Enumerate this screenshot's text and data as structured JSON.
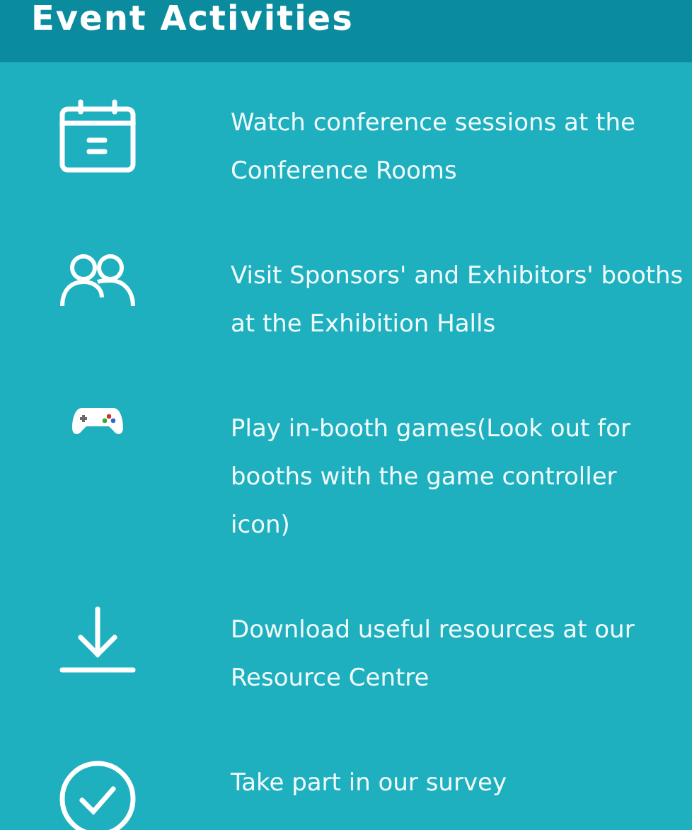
{
  "header": {
    "title": "Event Activities"
  },
  "activities": [
    {
      "kind": "calendar",
      "text": "Watch conference sessions at the Conference Rooms"
    },
    {
      "kind": "people",
      "text": "Visit Sponsors' and Exhibitors' booths at the Exhibition Halls"
    },
    {
      "kind": "gamepad",
      "text": "Play in-booth games(Look out for booths with the game controller icon)"
    },
    {
      "kind": "download",
      "text": "Download useful resources at our Resource Centre"
    },
    {
      "kind": "check",
      "text": "Take part in our survey"
    }
  ]
}
